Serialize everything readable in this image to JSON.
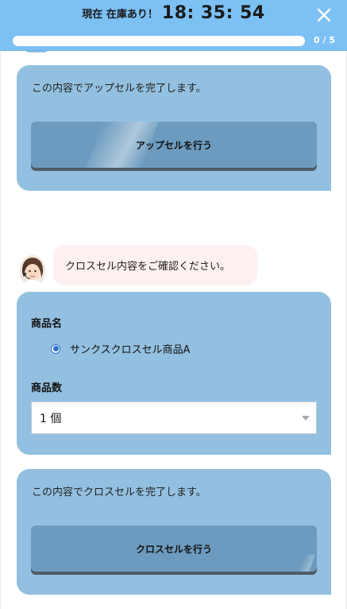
{
  "header": {
    "stock_label": "現在 在庫あり！",
    "timer": "18: 35: 54",
    "close_icon": "close-icon",
    "progress_value": 0,
    "progress_text": "0 / 5",
    "bg_color": "#7cc0f4"
  },
  "upsell": {
    "message": "この内容でアップセルを完了します。",
    "button_label": "アップセルを行う"
  },
  "chat": {
    "avatar_icon": "operator-avatar",
    "message": "クロスセル内容をご確認ください。"
  },
  "crosssell_form": {
    "product_label": "商品名",
    "product_option": "サンクスクロスセル商品A",
    "quantity_label": "商品数",
    "quantity_value": "1 個"
  },
  "crosssell": {
    "message": "この内容でクロスセルを完了します。",
    "button_label": "クロスセルを行う"
  },
  "colors": {
    "card": "#93c0e0",
    "button": "#6c9bbf",
    "bubble": "#fdf0f0",
    "radio": "#2f6fd3"
  }
}
